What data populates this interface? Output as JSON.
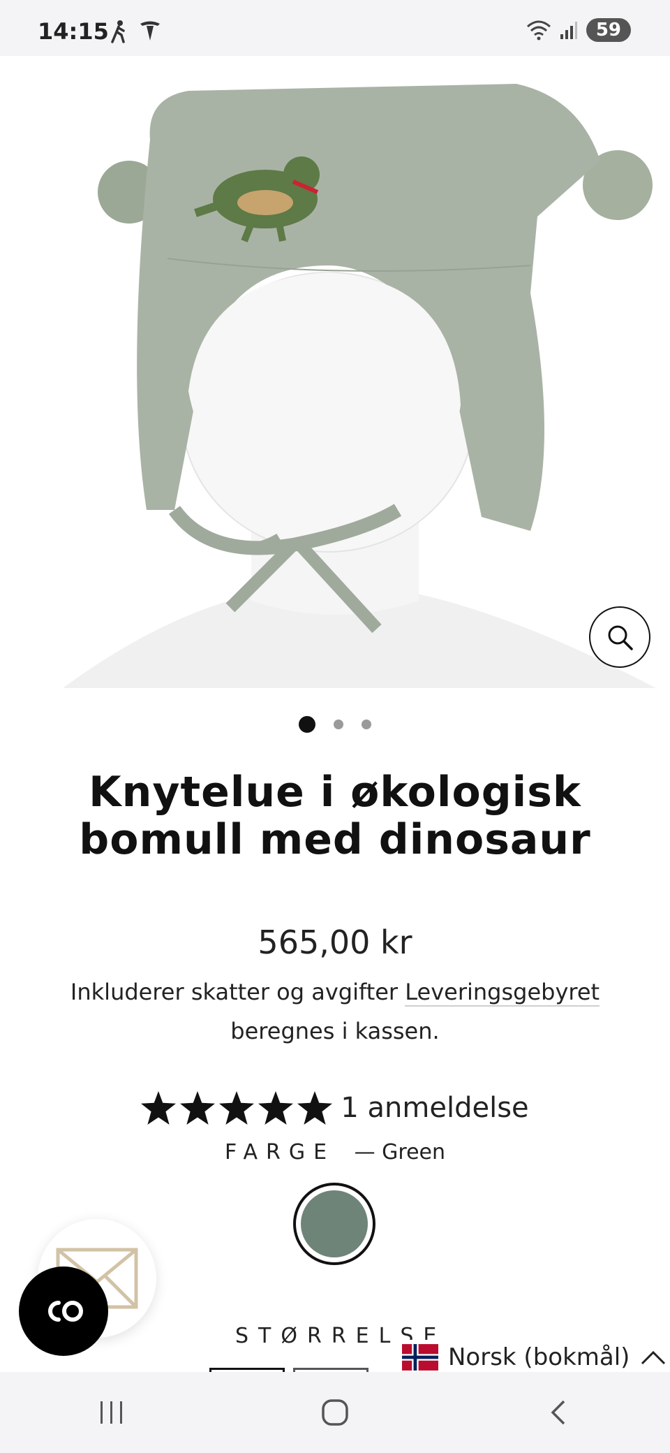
{
  "status_bar": {
    "time": "14:15",
    "battery": "59"
  },
  "product": {
    "title_line1": "Knytelue i økologisk",
    "title_line2": "bomull med dinosaur",
    "price": "565,00 kr",
    "tax_text": "Inkluderer skatter og avgifter",
    "shipping_link": "Leveringsgebyret",
    "tax_text2": "beregnes i kassen.",
    "rating_stars": 5,
    "reviews": "1 anmeldelse",
    "color_label": "FARGE",
    "color_value": "— Green",
    "swatch_color": "#6f8478",
    "size_label": "STØRRELSE"
  },
  "carousel": {
    "count": 3,
    "active": 1
  },
  "language": {
    "label": "Norsk (bokmål)"
  },
  "icons": {
    "zoom": "magnifier-icon",
    "mail": "envelope-icon",
    "chat": "co-chat-icon",
    "flag": "norway-flag-icon",
    "chevron": "chevron-up-icon"
  }
}
